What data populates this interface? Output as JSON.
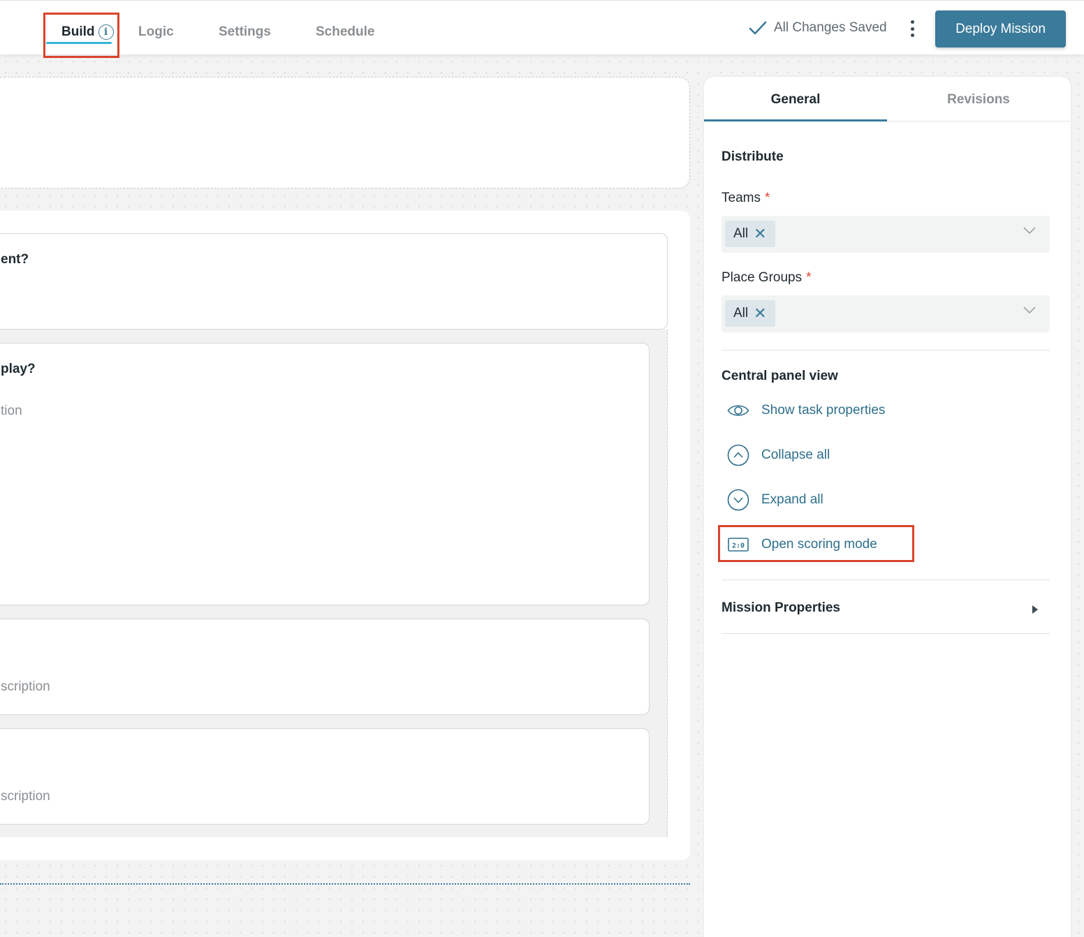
{
  "topbar": {
    "tabs": [
      {
        "label": "Build"
      },
      {
        "label": "Logic"
      },
      {
        "label": "Settings"
      },
      {
        "label": "Schedule"
      }
    ],
    "info_icon": "info-icon",
    "saved_status": "All Changes Saved",
    "deploy_label": "Deploy Mission"
  },
  "canvas": {
    "cards": [
      {
        "title": "ent?",
        "description": ""
      },
      {
        "title": "play?",
        "description": "tion"
      },
      {
        "title": "",
        "description": "scription"
      },
      {
        "title": "",
        "description": "scription"
      }
    ]
  },
  "sidebar": {
    "tabs": [
      {
        "label": "General"
      },
      {
        "label": "Revisions"
      }
    ],
    "distribute_heading": "Distribute",
    "teams": {
      "label": "Teams",
      "required_mark": "*",
      "chip": "All"
    },
    "place_groups": {
      "label": "Place Groups",
      "required_mark": "*",
      "chip": "All"
    },
    "central_panel_heading": "Central panel view",
    "actions": [
      {
        "label": "Show task properties",
        "icon": "eye-icon"
      },
      {
        "label": "Collapse all",
        "icon": "chevron-up-circle-icon"
      },
      {
        "label": "Expand all",
        "icon": "chevron-down-circle-icon"
      },
      {
        "label": "Open scoring mode",
        "icon": "scoreboard-icon",
        "icon_text": "2:0"
      }
    ],
    "mission_properties": "Mission Properties"
  },
  "colors": {
    "accent": "#3a7a9a",
    "highlight": "#d9442b",
    "tab_underline": "#35b5d6"
  }
}
